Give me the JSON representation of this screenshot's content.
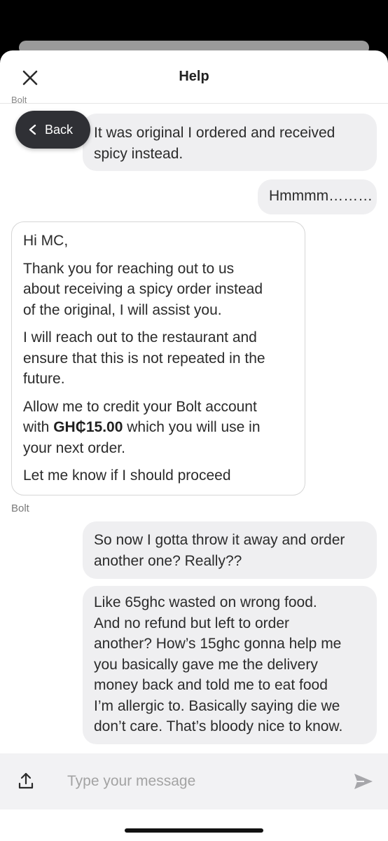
{
  "header": {
    "title": "Help"
  },
  "nav": {
    "back_label": "Back"
  },
  "messages": {
    "m1": {
      "lines": [
        "It was original I ordered and received",
        "spicy instead."
      ]
    },
    "m2": {
      "text": "Hmmmm………"
    },
    "bot": {
      "greeting": "Hi MC,",
      "p1": [
        "Thank you for reaching out to us",
        "about receiving a spicy order instead",
        "of the original, I will assist you."
      ],
      "p2": [
        "I will reach out to the restaurant and",
        "ensure that this is not repeated in the",
        "future."
      ],
      "p3_line1": "Allow me to credit your Bolt account",
      "p3_with": "with ",
      "p3_amount": "GH₵15.00",
      "p3_rest": " which you will use in",
      "p3_line3": "your next order.",
      "p4": "Let me know if I should proceed",
      "sender": "Bolt"
    },
    "m4": {
      "lines": [
        "So now I gotta throw it away and order",
        "another one? Really??"
      ]
    },
    "m5": {
      "lines": [
        "Like 65ghc wasted on wrong food.",
        "And no refund but left to order",
        "another? How’s 15ghc gonna help me",
        "you basically gave me the delivery",
        "money back and told me to eat food",
        "I’m allergic to. Basically saying die we",
        "don’t care. That’s bloody nice to know."
      ]
    }
  },
  "composer": {
    "placeholder": "Type your message"
  },
  "icons": {
    "close": "close-icon",
    "back": "chevron-left-icon",
    "upload": "upload-icon",
    "send": "send-icon"
  },
  "colors": {
    "bubble": "#efeff1",
    "back_button": "#2f3035",
    "composer": "#f2f2f4"
  }
}
